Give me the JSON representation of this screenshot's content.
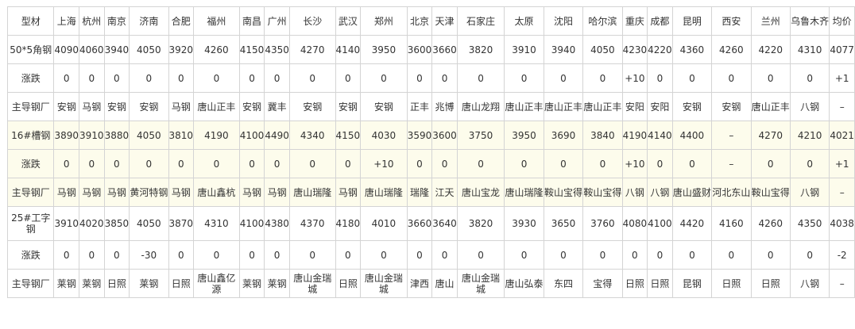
{
  "columns": [
    "型材",
    "上海",
    "杭州",
    "南京",
    "济南",
    "合肥",
    "福州",
    "南昌",
    "广州",
    "长沙",
    "武汉",
    "郑州",
    "北京",
    "天津",
    "石家庄",
    "太原",
    "沈阳",
    "哈尔滨",
    "重庆",
    "成都",
    "昆明",
    "西安",
    "兰州",
    "乌鲁木齐",
    "均价"
  ],
  "rows": [
    {
      "cells": [
        "50*5角钢",
        "4090",
        "4060",
        "3940",
        "4050",
        "3920",
        "4260",
        "4150",
        "4350",
        "4270",
        "4140",
        "3950",
        "3600",
        "3660",
        "3820",
        "3910",
        "3940",
        "4050",
        "4230",
        "4220",
        "4360",
        "4260",
        "4220",
        "4310",
        "4077"
      ]
    },
    {
      "cells": [
        "涨跌",
        "0",
        "0",
        "0",
        "0",
        "0",
        "0",
        "0",
        "0",
        "0",
        "0",
        "0",
        "0",
        "0",
        "0",
        "0",
        "0",
        "0",
        "+10",
        "0",
        "0",
        "0",
        "0",
        "0",
        "+1"
      ]
    },
    {
      "cells": [
        "主导钢厂",
        "安钢",
        "马钢",
        "安钢",
        "安钢",
        "马钢",
        "唐山正丰",
        "安钢",
        "冀丰",
        "安钢",
        "安钢",
        "安钢",
        "正丰",
        "兆博",
        "唐山龙翔",
        "唐山正丰",
        "唐山正丰",
        "唐山正丰",
        "安阳",
        "安阳",
        "安钢",
        "安钢",
        "唐山正丰",
        "八钢",
        "–"
      ]
    },
    {
      "cells": [
        "16#槽钢",
        "3890",
        "3910",
        "3880",
        "4050",
        "3810",
        "4190",
        "4100",
        "4490",
        "4340",
        "4150",
        "4030",
        "3590",
        "3600",
        "3750",
        "3950",
        "3690",
        "3840",
        "4190",
        "4140",
        "4400",
        "–",
        "4270",
        "4210",
        "4021"
      ]
    },
    {
      "cells": [
        "涨跌",
        "0",
        "0",
        "0",
        "0",
        "0",
        "0",
        "0",
        "0",
        "0",
        "0",
        "+10",
        "0",
        "0",
        "0",
        "0",
        "0",
        "0",
        "+10",
        "0",
        "0",
        "–",
        "0",
        "0",
        "+1"
      ]
    },
    {
      "cells": [
        "主导钢厂",
        "马钢",
        "马钢",
        "马钢",
        "黄河特钢",
        "马钢",
        "唐山鑫杭",
        "马钢",
        "马钢",
        "唐山瑞隆",
        "马钢",
        "唐山瑞隆",
        "瑞隆",
        "江天",
        "唐山宝龙",
        "唐山瑞隆",
        "鞍山宝得",
        "鞍山宝得",
        "八钢",
        "八钢",
        "唐山盛财",
        "河北东山",
        "鞍山宝得",
        "八钢",
        "–"
      ]
    },
    {
      "cells": [
        "25#工字钢",
        "3910",
        "4020",
        "3850",
        "4050",
        "3870",
        "4310",
        "4100",
        "4380",
        "4370",
        "4180",
        "4010",
        "3660",
        "3640",
        "3820",
        "3930",
        "3650",
        "3760",
        "4080",
        "4100",
        "4420",
        "4160",
        "4260",
        "4350",
        "4038"
      ]
    },
    {
      "cells": [
        "涨跌",
        "0",
        "0",
        "0",
        "-30",
        "0",
        "0",
        "0",
        "0",
        "0",
        "0",
        "0",
        "0",
        "0",
        "0",
        "0",
        "0",
        "0",
        "0",
        "0",
        "0",
        "0",
        "0",
        "0",
        "-2"
      ]
    },
    {
      "cells": [
        "主导钢厂",
        "莱钢",
        "莱钢",
        "日照",
        "莱钢",
        "日照",
        "唐山鑫亿源",
        "莱钢",
        "莱钢",
        "唐山金瑞城",
        "日照",
        "唐山金瑞城",
        "津西",
        "唐山",
        "唐山金瑞城",
        "唐山弘泰",
        "东四",
        "宝得",
        "日照",
        "日照",
        "昆钢",
        "日照",
        "日照",
        "八钢",
        "–"
      ]
    }
  ]
}
